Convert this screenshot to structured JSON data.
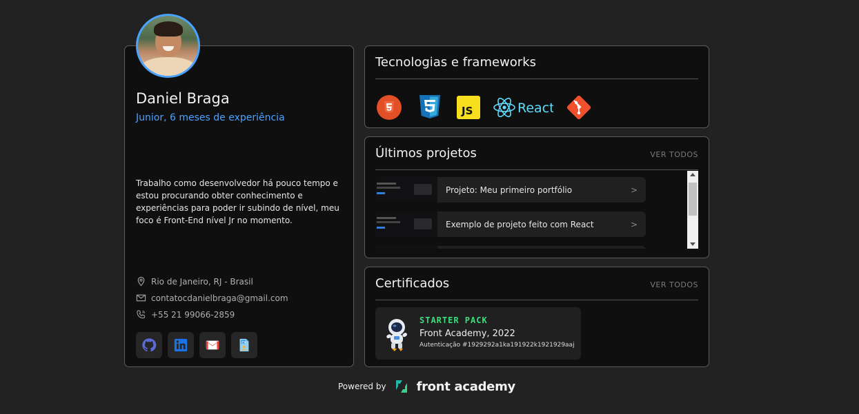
{
  "profile": {
    "name": "Daniel Braga",
    "role": "Junior, 6 meses de experiência",
    "bio": "Trabalho como desenvolvedor há pouco tempo e estou procurando obter conhecimento e experiências para poder ir subindo de nível, meu foco é Front-End nível Jr no momento.",
    "location": "Rio de Janeiro, RJ - Brasil",
    "email": "contatocdanielbraga@gmail.com",
    "phone": "+55 21 99066-2859",
    "socials": [
      "github-icon",
      "linkedin-icon",
      "gmail-icon",
      "cv-icon"
    ]
  },
  "techs": {
    "title": "Tecnologias e frameworks",
    "items": [
      {
        "icon": "html5-icon"
      },
      {
        "icon": "css3-icon"
      },
      {
        "icon": "javascript-icon",
        "label": "JS"
      },
      {
        "icon": "react-icon",
        "label": "React"
      },
      {
        "icon": "git-icon"
      }
    ]
  },
  "projects": {
    "title": "Últimos projetos",
    "see_all": "VER TODOS",
    "items": [
      {
        "label": "Projeto: Meu primeiro portfólio",
        "arrow": ">"
      },
      {
        "label": "Exemplo de projeto feito com React",
        "arrow": ">"
      }
    ]
  },
  "certificates": {
    "title": "Certificados",
    "see_all": "VER TODOS",
    "items": [
      {
        "name": "STARTER PACK",
        "org": "Front Academy, 2022",
        "auth": "Autenticação #1929292a1ka191922k1921929aaj"
      }
    ]
  },
  "footer": {
    "powered": "Powered by",
    "brand": "front academy"
  },
  "colors": {
    "background": "#222222",
    "card": "#0f0f10",
    "accent": "#4aa3ff",
    "cert_green": "#3ddc7a"
  }
}
